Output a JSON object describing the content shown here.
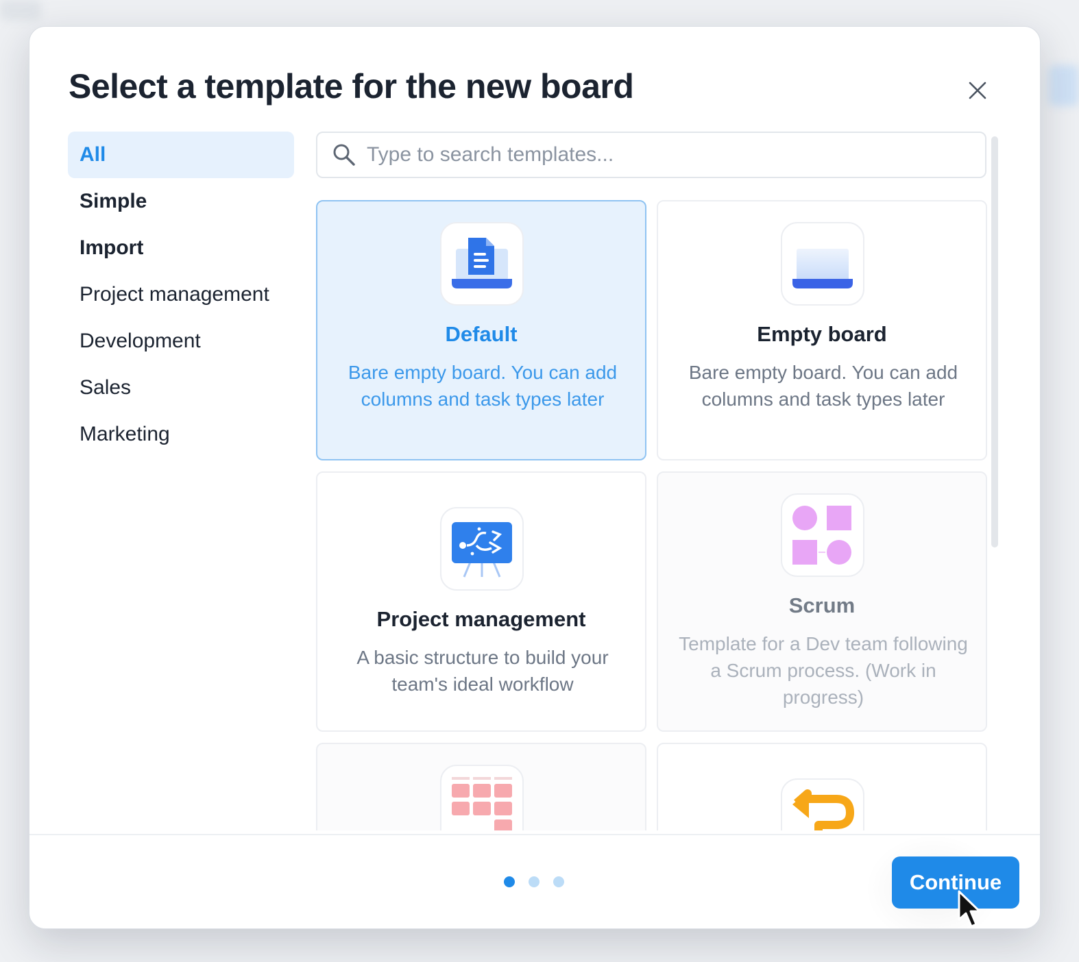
{
  "dialog": {
    "title": "Select a template for the new board",
    "close_icon": "close-icon"
  },
  "sidebar": {
    "items": [
      {
        "label": "All",
        "active": true,
        "bold": true
      },
      {
        "label": "Simple",
        "active": false,
        "bold": true
      },
      {
        "label": "Import",
        "active": false,
        "bold": true
      },
      {
        "label": "Project management",
        "active": false,
        "bold": false
      },
      {
        "label": "Development",
        "active": false,
        "bold": false
      },
      {
        "label": "Sales",
        "active": false,
        "bold": false
      },
      {
        "label": "Marketing",
        "active": false,
        "bold": false
      }
    ]
  },
  "search": {
    "placeholder": "Type to search templates...",
    "value": "",
    "icon": "search-icon"
  },
  "templates": [
    {
      "title": "Default",
      "description": "Bare empty board. You can add columns and task types later",
      "icon": "document-tray-icon",
      "state": "selected"
    },
    {
      "title": "Empty board",
      "description": "Bare empty board. You can add columns and task types later",
      "icon": "empty-tray-icon",
      "state": "normal"
    },
    {
      "title": "Project management",
      "description": "A basic structure to build your team's ideal workflow",
      "icon": "workflow-board-icon",
      "state": "normal"
    },
    {
      "title": "Scrum",
      "description": "Template for a Dev team following a Scrum process. (Work in progress)",
      "icon": "shapes-icon",
      "state": "disabled"
    },
    {
      "title": "",
      "description": "",
      "icon": "grid-calendar-icon",
      "state": "disabled"
    },
    {
      "title": "",
      "description": "",
      "icon": "return-arrow-icon",
      "state": "normal"
    }
  ],
  "pagination": {
    "pages": 3,
    "current": 1
  },
  "footer": {
    "continue_label": "Continue"
  },
  "colors": {
    "accent": "#1f8ae8",
    "selected_bg": "#e7f2fd",
    "title_text": "#1b2330"
  }
}
